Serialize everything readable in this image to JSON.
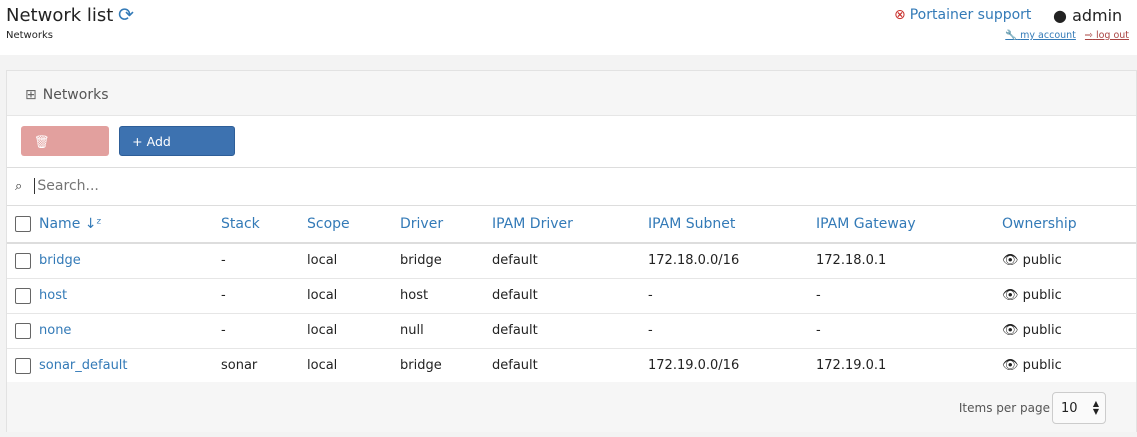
{
  "header": {
    "title": "Network list",
    "breadcrumb": "Networks",
    "support": "Portainer support",
    "user": "admin",
    "my_account": "my account",
    "log_out": "log out"
  },
  "widget": {
    "title": "Networks",
    "remove_label": "Remove",
    "add_label": "Add network",
    "search_placeholder": "Search..."
  },
  "table": {
    "columns": [
      "Name",
      "Stack",
      "Scope",
      "Driver",
      "IPAM Driver",
      "IPAM Subnet",
      "IPAM Gateway",
      "Ownership"
    ],
    "rows": [
      [
        "bridge",
        "-",
        "local",
        "bridge",
        "default",
        "172.18.0.0/16",
        "172.18.0.1",
        "public"
      ],
      [
        "host",
        "-",
        "local",
        "host",
        "default",
        "-",
        "-",
        "public"
      ],
      [
        "none",
        "-",
        "local",
        "null",
        "default",
        "-",
        "-",
        "public"
      ],
      [
        "sonar_default",
        "sonar",
        "local",
        "bridge",
        "default",
        "172.19.0.0/16",
        "172.19.0.1",
        "public"
      ]
    ]
  },
  "footer": {
    "items_label": "Items per page",
    "items_value": "10"
  }
}
